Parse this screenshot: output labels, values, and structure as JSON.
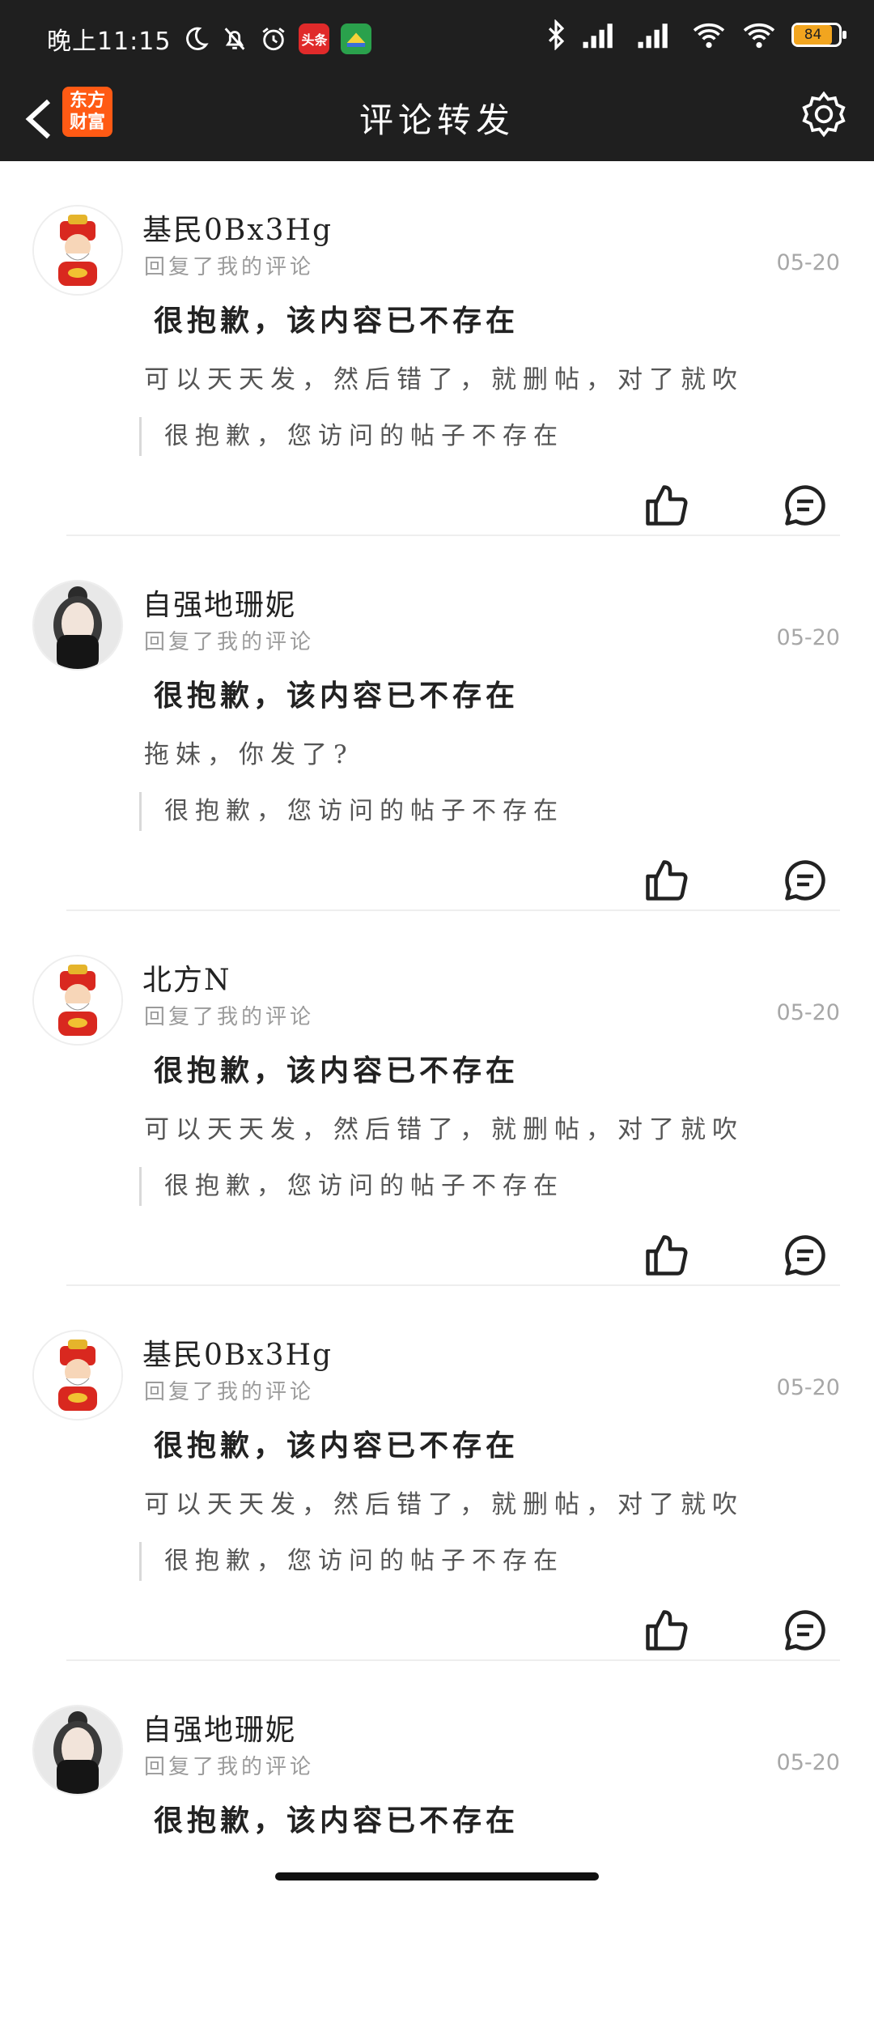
{
  "status_bar": {
    "time": "晚上11:15",
    "app_tag_1": "头条",
    "battery_level": "84"
  },
  "nav": {
    "title": "评论转发",
    "logo_line1": "东方",
    "logo_line2": "财富"
  },
  "items": [
    {
      "username": "基民0Bx3Hg",
      "avatar": "caishen-avatar",
      "subtext": "回复了我的评论",
      "date": "05-20",
      "headline": "很抱歉，该内容已不存在",
      "body": "可以天天发，然后错了，就删帖，对了就吹",
      "quote": "很抱歉，您访问的帖子不存在"
    },
    {
      "username": "自强地珊妮",
      "avatar": "girl-avatar",
      "subtext": "回复了我的评论",
      "date": "05-20",
      "headline": "很抱歉，该内容已不存在",
      "body": "拖妹，你发了?",
      "quote": "很抱歉，您访问的帖子不存在"
    },
    {
      "username": "北方N",
      "avatar": "caishen-avatar",
      "subtext": "回复了我的评论",
      "date": "05-20",
      "headline": "很抱歉，该内容已不存在",
      "body": "可以天天发，然后错了，就删帖，对了就吹",
      "quote": "很抱歉，您访问的帖子不存在"
    },
    {
      "username": "基民0Bx3Hg",
      "avatar": "caishen-avatar",
      "subtext": "回复了我的评论",
      "date": "05-20",
      "headline": "很抱歉，该内容已不存在",
      "body": "可以天天发，然后错了，就删帖，对了就吹",
      "quote": "很抱歉，您访问的帖子不存在"
    },
    {
      "username": "自强地珊妮",
      "avatar": "girl-avatar",
      "subtext": "回复了我的评论",
      "date": "05-20",
      "headline": "很抱歉，该内容已不存在"
    }
  ],
  "colors": {
    "header_bg": "#1f1f1f",
    "brand_orange": "#ff5a14",
    "battery": "#f2a51f"
  }
}
